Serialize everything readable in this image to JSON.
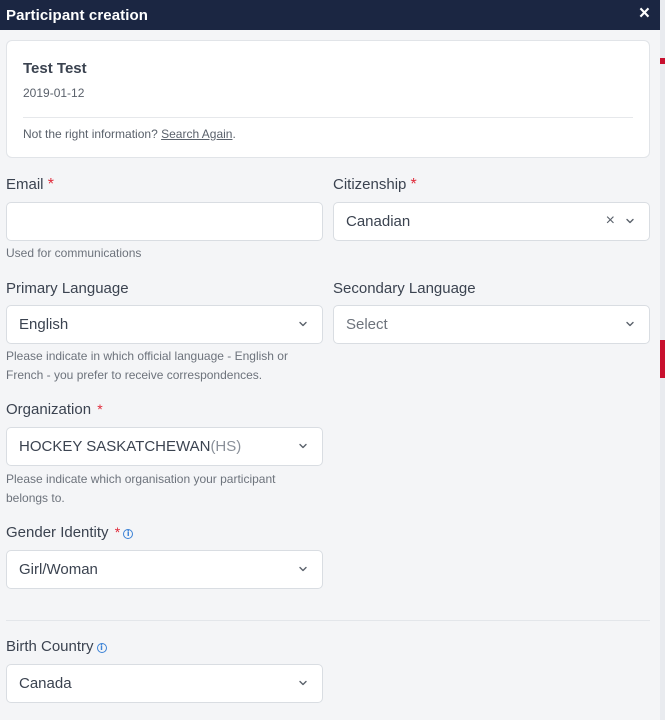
{
  "modal": {
    "title": "Participant creation",
    "close_label": "×"
  },
  "participant": {
    "name": "Test Test",
    "dob": "2019-01-12",
    "not_right_text": "Not the right information?",
    "search_again": "Search Again",
    "period": "."
  },
  "fields": {
    "email": {
      "label": "Email",
      "required": "*",
      "value": "",
      "hint": "Used for communications"
    },
    "citizenship": {
      "label": "Citizenship",
      "required": "*",
      "value": "Canadian",
      "clear": "×"
    },
    "primary_language": {
      "label": "Primary Language",
      "value": "English",
      "hint_line1": "Please indicate in which official language - English or",
      "hint_line2": "French - you prefer to receive correspondences."
    },
    "secondary_language": {
      "label": "Secondary Language",
      "placeholder": "Select"
    },
    "organization": {
      "label": "Organization",
      "required": "*",
      "value": "HOCKEY SASKATCHEWAN",
      "value_suffix": "(HS)",
      "hint_line1": "Please indicate which organisation your participant",
      "hint_line2": "belongs to."
    },
    "gender_identity": {
      "label": "Gender Identity",
      "required": "*",
      "value": "Girl/Woman"
    },
    "birth_country": {
      "label": "Birth Country",
      "value": "Canada"
    }
  },
  "icons": {
    "info": "i"
  },
  "colors": {
    "header": "#1b2642",
    "required": "#e02a3a",
    "info": "#3b82d6"
  }
}
